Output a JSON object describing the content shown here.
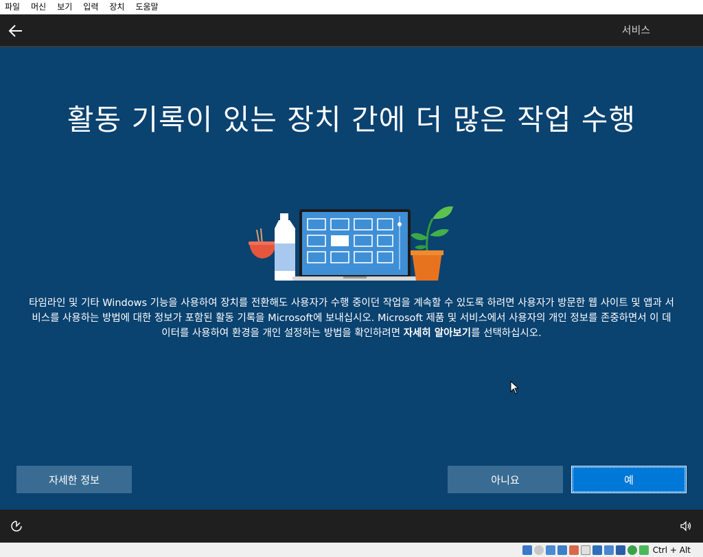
{
  "menubar": {
    "items": [
      "파일",
      "머신",
      "보기",
      "입력",
      "장치",
      "도움말"
    ]
  },
  "topbar": {
    "back_icon": "arrow-left-icon",
    "tab_label": "서비스"
  },
  "main": {
    "title": "활동 기록이 있는 장치 간에 더 많은 작업 수행",
    "description_part1": "타임라인 및 기타 Windows 기능을 사용하여 장치를 전환해도 사용자가 수행 중이던 작업을 계속할 수 있도록 하려면 사용자가 방문한 웹 사이트 및 앱과 서비스를 사용하는 방법에 대한 정보가 포함된 활동 기록을 Microsoft에 보내십시오. Microsoft 제품 및 서비스에서 사용자의 개인 정보를 존중하면서 이 데이터를 사용하여 환경을 개인 설정하는 방법을 확인하려면 ",
    "description_bold": "자세히 알아보기",
    "description_part2": "를 선택하십시오."
  },
  "buttons": {
    "more_info": "자세한 정보",
    "no": "아니요",
    "yes": "예"
  },
  "statusbar": {
    "host_key": "Ctrl + Alt"
  },
  "colors": {
    "background": "#0a4270",
    "bar": "#1f1f1f",
    "accent": "#0078d7",
    "secondary_button": "#3a6c93"
  }
}
